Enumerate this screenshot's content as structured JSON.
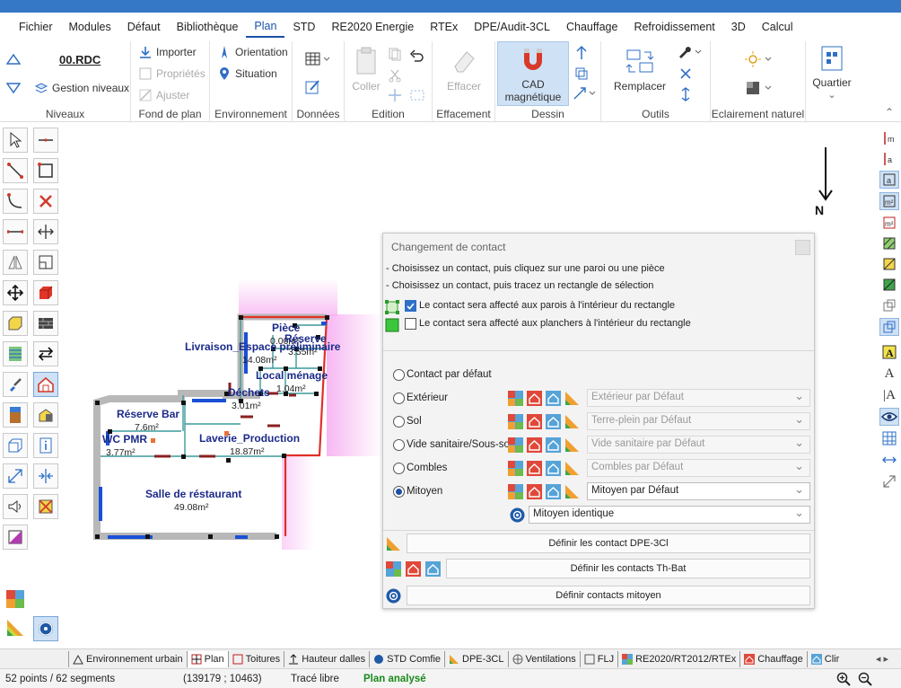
{
  "menu": {
    "items": [
      "Fichier",
      "Modules",
      "Défaut",
      "Bibliothèque",
      "Plan",
      "STD",
      "RE2020 Energie",
      "RTEx",
      "DPE/Audit-3CL",
      "Chauffage",
      "Refroidissement",
      "3D",
      "Calcul"
    ],
    "active": "Plan"
  },
  "ribbon": {
    "niveaux": {
      "level": "00.RDC",
      "gestion": "Gestion niveaux",
      "label": "Niveaux"
    },
    "fond": {
      "importer": "Importer",
      "proprietes": "Propriétés",
      "ajuster": "Ajuster",
      "label": "Fond de plan"
    },
    "env": {
      "orientation": "Orientation",
      "situation": "Situation",
      "label": "Environnement"
    },
    "donnees": {
      "label": "Données"
    },
    "edition": {
      "coller": "Coller",
      "label": "Edition"
    },
    "effacement": {
      "effacer": "Effacer",
      "label": "Effacement"
    },
    "dessin": {
      "cad": "CAD",
      "cad2": "magnétique",
      "label": "Dessin"
    },
    "outils": {
      "remplacer": "Remplacer",
      "label": "Outils"
    },
    "eclairage": {
      "label": "Eclairement naturel"
    },
    "quartier": {
      "btn": "Quartier"
    }
  },
  "plan": {
    "north": "N",
    "rooms": [
      {
        "name": "Pièce",
        "area": "0.00m²"
      },
      {
        "name": "Réserve",
        "area": "3.55m²"
      },
      {
        "name": "Livraison_Espace préliminaire",
        "area": "14.08m²"
      },
      {
        "name": "Local ménage",
        "area": "1.04m²"
      },
      {
        "name": "Déchets",
        "area": "3.01m²"
      },
      {
        "name": "Réserve Bar",
        "area": "7.6m²"
      },
      {
        "name": "WC PMR",
        "area": "3.77m²"
      },
      {
        "name": "Laverie_Production",
        "area": "18.87m²"
      },
      {
        "name": "Salle de réstaurant",
        "area": "49.08m²"
      }
    ]
  },
  "dialog": {
    "title": "Changement de contact",
    "instr1": "- Choisissez un contact, puis cliquez sur une paroi ou une pièce",
    "instr2": "- Choisissez un contact, puis tracez un rectangle de sélection",
    "chk1": "Le contact sera affecté aux parois à l'intérieur du rectangle",
    "chk2": "Le contact sera affecté aux planchers à l'intérieur du rectangle",
    "options": [
      {
        "label": "Contact par défaut",
        "select": ""
      },
      {
        "label": "Extérieur",
        "select": "Extérieur par Défaut"
      },
      {
        "label": "Sol",
        "select": "Terre-plein par Défaut"
      },
      {
        "label": "Vide sanitaire/Sous-sol",
        "select": "Vide sanitaire par Défaut"
      },
      {
        "label": "Combles",
        "select": "Combles par Défaut"
      },
      {
        "label": "Mitoyen",
        "select": "Mitoyen par Défaut"
      }
    ],
    "mitoyen_sub": "Mitoyen identique",
    "btn_dpe": "Définir les contact DPE-3Cl",
    "btn_thbat": "Définir les contacts Th-Bat",
    "btn_mitoyen": "Définir contacts mitoyen"
  },
  "tabs": [
    "Environnement urbain",
    "Plan",
    "Toitures",
    "Hauteur dalles",
    "STD Comfie",
    "DPE-3CL",
    "Ventilations",
    "FLJ",
    "RE2020/RT2012/RTEx",
    "Chauffage",
    "Clir"
  ],
  "status": {
    "points": "52 points / 62 segments",
    "coords": "(139179 ; 10463)",
    "mode": "Tracé libre",
    "state": "Plan analysé"
  }
}
